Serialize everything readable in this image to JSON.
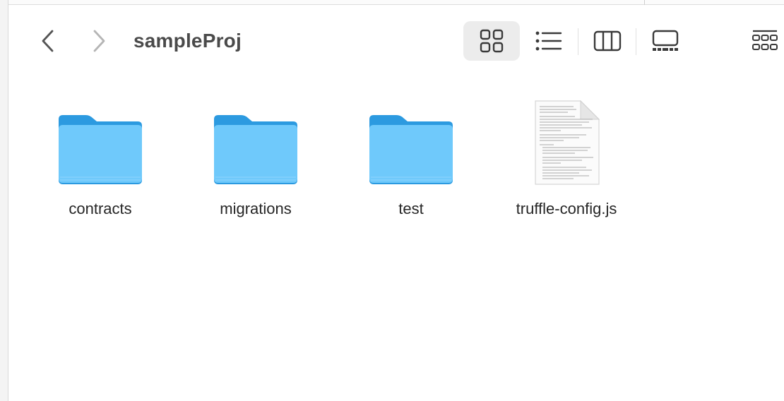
{
  "window": {
    "title": "sampleProj"
  },
  "toolbar": {
    "back_icon": "chevron-left-icon",
    "forward_icon": "chevron-right-icon",
    "views": [
      {
        "id": "icons",
        "icon": "icon-view-grid-icon",
        "active": true
      },
      {
        "id": "list",
        "icon": "list-view-icon",
        "active": false
      },
      {
        "id": "columns",
        "icon": "column-view-icon",
        "active": false
      },
      {
        "id": "gallery",
        "icon": "gallery-view-icon",
        "active": false
      },
      {
        "id": "group",
        "icon": "group-grid-icon",
        "active": false
      }
    ]
  },
  "items": [
    {
      "name": "contracts",
      "kind": "folder"
    },
    {
      "name": "migrations",
      "kind": "folder"
    },
    {
      "name": "test",
      "kind": "folder"
    },
    {
      "name": "truffle-config.js",
      "kind": "document"
    }
  ],
  "colors": {
    "folder_front": "#6fc9fb",
    "folder_back": "#2c9ae0",
    "title_text": "#4a4a4a",
    "active_view_bg": "#ececec"
  }
}
